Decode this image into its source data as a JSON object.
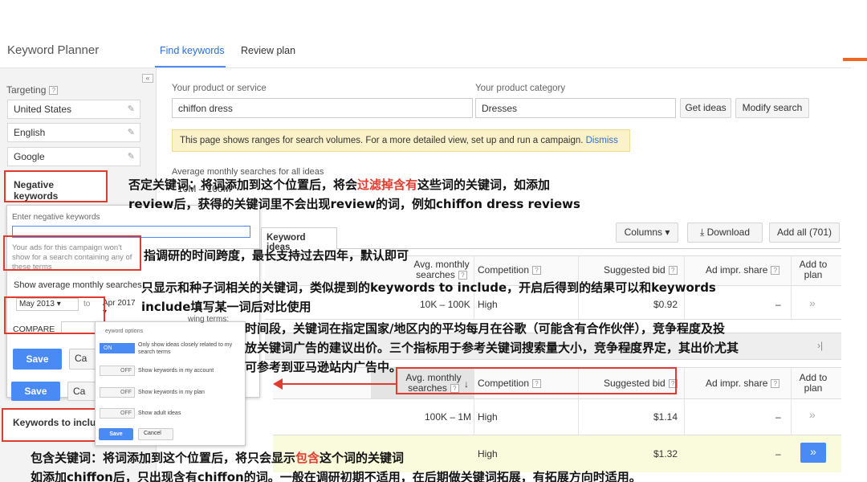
{
  "app": {
    "title": "Keyword Planner",
    "tabs": [
      "Find keywords",
      "Review plan"
    ],
    "collapse_glyph": "«"
  },
  "sidebar": {
    "targeting_label": "Targeting",
    "help_glyph": "?",
    "targets": [
      "United States",
      "English",
      "Google"
    ],
    "pencil_glyph": "✎",
    "negative_keywords_label": "Negative keywords",
    "enter_negative_label": "Enter negative keywords",
    "ads_note": "Your ads for this campaign won't show for a search containing any of these terms",
    "show_avg_label": "Show average monthly searches",
    "date_start": "May 2013 ▾",
    "date_to": "to",
    "date_end": "Apr 2017 ▾",
    "compare_label": "COMPARE",
    "save_label": "Save",
    "cancel_label": "Ca",
    "keywords_include_label": "Keywords to inclu",
    "showing_terms": "wing terms:"
  },
  "keyword_options": {
    "title": "eyword options",
    "options": [
      {
        "state": "ON",
        "label": "Only show ideas closely related to my search terms"
      },
      {
        "state": "OFF",
        "label": "Show keywords in my account"
      },
      {
        "state": "OFF",
        "label": "Show keywords in my plan"
      },
      {
        "state": "OFF",
        "label": "Show adult ideas"
      }
    ],
    "save_label": "Save",
    "cancel_label": "Cancel"
  },
  "search": {
    "product_label": "Your product or service",
    "product_value": "chiffon dress",
    "category_label": "Your product category",
    "category_value": "Dresses",
    "get_ideas": "Get ideas",
    "modify_search": "Modify search"
  },
  "notice": {
    "text": "This page shows ranges for search volumes. For a more detailed view, set up and run a campaign. ",
    "dismiss": "Dismiss"
  },
  "avg": {
    "title": "Average monthly searches for all ideas",
    "range": "10M – 100M"
  },
  "toolbar": {
    "keyword_ideas_tab": "Keyword ideas",
    "columns": "Columns ▾",
    "download": "Download",
    "download_glyph": "⤓",
    "add_all": "Add all (701)"
  },
  "table1": {
    "headers": {
      "avg_monthly": "Avg. monthly",
      "searches": "searches",
      "competition": "Competition",
      "suggested_bid": "Suggested bid",
      "ad_impr_share": "Ad impr. share",
      "add_to": "Add to",
      "plan": "plan"
    },
    "row": {
      "searches": "10K – 100K",
      "competition": "High",
      "bid": "$0.92",
      "share": "–",
      "add": "»"
    }
  },
  "summary": {
    "text": "30",
    "nav": "›|"
  },
  "table2": {
    "headers": {
      "avg_monthly": "Avg. monthly",
      "searches": "searches",
      "sort_glyph": "↓",
      "competition": "Competition",
      "suggested_bid": "Suggested bid",
      "ad_impr_share": "Ad impr. share",
      "add_to": "Add to",
      "plan": "plan"
    },
    "rows": [
      {
        "searches": "100K – 1M",
        "competition": "High",
        "bid": "$1.14",
        "share": "–",
        "add": "»"
      },
      {
        "searches": "",
        "competition": "High",
        "bid": "$1.32",
        "share": "–",
        "add": "»"
      }
    ]
  },
  "annotations": {
    "neg_1": "否定关键词：将词添加到这个位置后，将会",
    "neg_red": "过滤掉含有",
    "neg_2": "这些词的关键词，如添加",
    "neg_3": "review后，获得的关键词里不会出现review的词，例如chiffon dress reviews",
    "date": "指调研的时间跨度，最长支持过去四年，默认即可",
    "related_1": "只显示和种子词相关的关键词，类似提到的keywords to include，开启后得到的结果可以和keywords",
    "related_2": "include填写某一词后对比使用",
    "stats_1": "时间段，关键词在指定国家/地区内的平均每月在谷歌（可能含有合作伙伴），竞争程度及投",
    "stats_2": "放关键词广告的建议出价。三个指标用于参考关键词搜索量大小，竞争程度界定，其出价尤其",
    "stats_3": "可参考到亚马逊站内广告中。",
    "include_1": "包含关键词：将词添加到这个位置后，将只会显示",
    "include_red": "包含",
    "include_2": "这个词的关键词",
    "include_3": "如添加chiffon后，只出现含有chiffon的词。一般在调研初期不适用，在后期做关键词拓展，有拓展方向时适用。"
  }
}
